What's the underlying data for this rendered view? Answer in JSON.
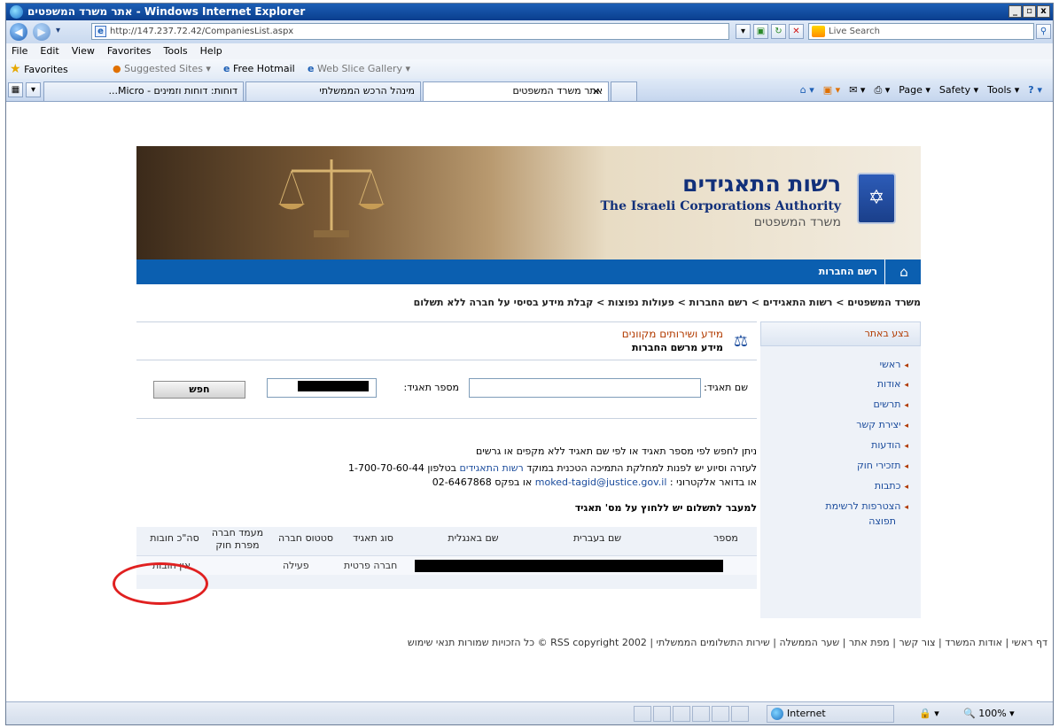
{
  "window": {
    "title": "אתר משרד המשפטים - Windows Internet Explorer",
    "min": "_",
    "max": "▫",
    "close": "x"
  },
  "address": {
    "url": "http://147.237.72.42/CompaniesList.aspx",
    "search_placeholder": "Live Search"
  },
  "menu": [
    "File",
    "Edit",
    "View",
    "Favorites",
    "Tools",
    "Help"
  ],
  "favorites": {
    "label": "Favorites",
    "items": [
      "Suggested Sites ▾",
      "Free Hotmail",
      "Web Slice Gallery ▾"
    ]
  },
  "tabs": [
    {
      "label": "דוחות: דוחות וזמינים - Micro..."
    },
    {
      "label": "מינהל הרכש הממשלתי"
    },
    {
      "label": "אתר משרד המשפטים"
    }
  ],
  "commands": [
    "Page ▾",
    "Safety ▾",
    "Tools ▾"
  ],
  "banner": {
    "hebrew_title": "רשות התאגידים",
    "english_title": "The Israeli Corporations Authority",
    "ministry": "משרד המשפטים"
  },
  "nav": {
    "registry": "רשם החברות"
  },
  "breadcrumb": "משרד המשפטים > רשות התאגידים > רשם החברות > פעולות נפוצות > קבלת מידע בסיסי על חברה ללא תשלום",
  "sidebar": {
    "heading": "בצע באתר",
    "items": [
      "ראשי",
      "אודות",
      "תרשים",
      "יצירת קשר",
      "הודעות",
      "תזכירי חוק",
      "כתבות",
      "הצטרפות לרשימת",
      "תפוצה"
    ]
  },
  "content": {
    "heading1": "מידע ושירותים מקוונים",
    "heading2": "מידע מרשם החברות"
  },
  "form": {
    "name_label": "שם תאגיד:",
    "number_label": "מספר תאגיד:",
    "search_button": "חפש"
  },
  "info": {
    "line1": "ניתן לחפש לפי מספר תאגיד או לפי שם תאגיד ללא מקפים או גרשים",
    "line2_prefix": "לעזרה וסיוע יש לפנות למחלקת התמיכה הטכנית במוקד",
    "line2_link": "רשות התאגידים",
    "line2_suffix": "בטלפון 1-700-70-60-44",
    "line3_prefix": "או בדואר אלקטרוני :",
    "line3_email": "moked-tagid@justice.gov.il",
    "line3_suffix": "או בפקס 02-6467868",
    "line4": "למעבר לתשלום יש ללחוץ על מס' תאגיד"
  },
  "table": {
    "headers": [
      "מספר",
      "שם בעברית",
      "שם באנגלית",
      "סוג תאגיד",
      "סטטוס חברה",
      "מעמד חברה מפרת חוק",
      "סה\"כ חובות"
    ],
    "row": {
      "type": "חברה פרטית",
      "status": "פעילה",
      "debts": "אין חובות"
    }
  },
  "footer": "דף ראשי | אודות המשרד | צור קשר | מפת אתר | שער הממשלה | שירות התשלומים הממשלתי | RSS  copyright 2002 © כל הזכויות שמורות  תנאי שימוש",
  "status": {
    "zone": "Internet",
    "zoom": "100%"
  }
}
